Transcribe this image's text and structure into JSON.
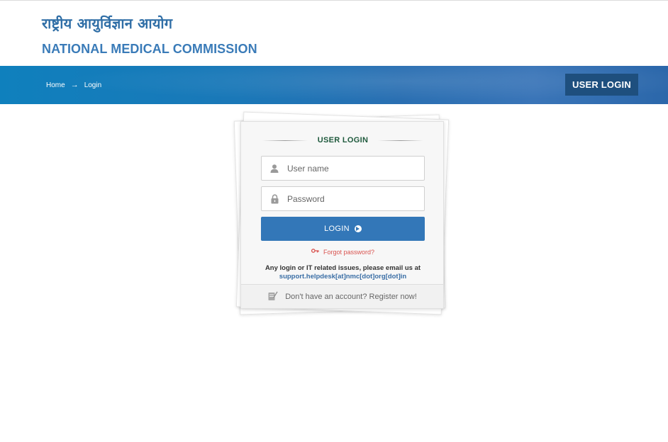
{
  "header": {
    "hindi_title": "राष्ट्रीय आयुर्विज्ञान आयोग",
    "english_title": "NATIONAL MEDICAL COMMISSION"
  },
  "banner": {
    "breadcrumb": {
      "home": "Home",
      "separator": "→",
      "current": "Login"
    },
    "page_badge": "USER LOGIN"
  },
  "login_card": {
    "title": "USER LOGIN",
    "username": {
      "placeholder": "User name",
      "value": "",
      "icon": "user-icon"
    },
    "password": {
      "placeholder": "Password",
      "value": "",
      "icon": "lock-icon"
    },
    "submit_label": "LOGIN",
    "submit_icon": "arrow-circle-right-icon",
    "forgot_label": "Forgot password?",
    "forgot_icon": "key-icon",
    "help_text": "Any login or IT related issues, please email us at",
    "help_email": "support.helpdesk[at]nmc[dot]org[dot]in",
    "register_text": "Don't have an account? Register now!",
    "register_icon": "edit-document-icon"
  },
  "colors": {
    "brand_blue": "#3a7bb8",
    "button_blue": "#3377b8",
    "badge_navy": "#1e4f7e",
    "forgot_red": "#d9534f",
    "title_green": "#1f5a3d"
  }
}
